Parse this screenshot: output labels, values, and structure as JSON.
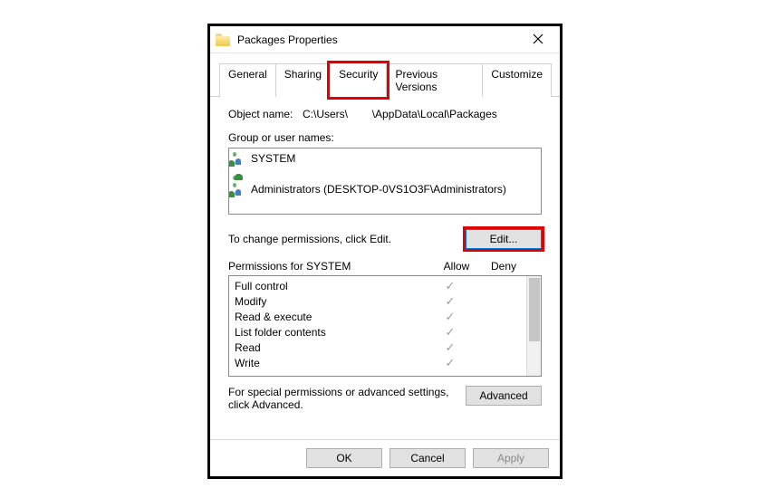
{
  "window": {
    "title": "Packages Properties"
  },
  "tabs": {
    "general": "General",
    "sharing": "Sharing",
    "security": "Security",
    "previous": "Previous Versions",
    "customize": "Customize"
  },
  "object": {
    "label": "Object name:",
    "path_prefix": "C:\\Users\\",
    "path_suffix": "\\AppData\\Local\\Packages"
  },
  "group_label": "Group or user names:",
  "groups": [
    {
      "name": "SYSTEM",
      "type": "group"
    },
    {
      "name": "",
      "type": "user"
    },
    {
      "name": "Administrators (DESKTOP-0VS1O3F\\Administrators)",
      "type": "group"
    }
  ],
  "edit_hint": "To change permissions, click Edit.",
  "edit_button": "Edit...",
  "perm_title": "Permissions for SYSTEM",
  "perm_cols": {
    "allow": "Allow",
    "deny": "Deny"
  },
  "permissions": [
    {
      "name": "Full control",
      "allow": true,
      "deny": false
    },
    {
      "name": "Modify",
      "allow": true,
      "deny": false
    },
    {
      "name": "Read & execute",
      "allow": true,
      "deny": false
    },
    {
      "name": "List folder contents",
      "allow": true,
      "deny": false
    },
    {
      "name": "Read",
      "allow": true,
      "deny": false
    },
    {
      "name": "Write",
      "allow": true,
      "deny": false
    }
  ],
  "advanced_hint": "For special permissions or advanced settings, click Advanced.",
  "advanced_button": "Advanced",
  "footer": {
    "ok": "OK",
    "cancel": "Cancel",
    "apply": "Apply"
  }
}
